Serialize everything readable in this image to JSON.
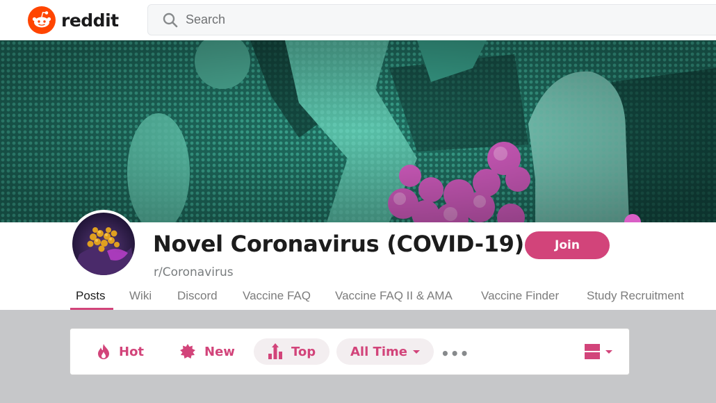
{
  "header": {
    "brand": "reddit",
    "search_placeholder": "Search"
  },
  "subreddit": {
    "title": "Novel Coronavirus (COVID-19)",
    "name": "r/Coronavirus",
    "join_label": "Join"
  },
  "tabs": [
    {
      "label": "Posts",
      "active": true
    },
    {
      "label": "Wiki"
    },
    {
      "label": "Discord"
    },
    {
      "label": "Vaccine FAQ"
    },
    {
      "label": "Vaccine FAQ II & AMA"
    },
    {
      "label": "Vaccine Finder"
    },
    {
      "label": "Study Recruitment"
    }
  ],
  "sort": {
    "hot": "Hot",
    "new": "New",
    "top": "Top",
    "time": "All Time",
    "more": "•••"
  },
  "colors": {
    "accent": "#d2447a",
    "reddit_orange": "#ff4500",
    "banner_teal": "#2e8f7c"
  },
  "icons": {
    "logo": "reddit-logo-icon",
    "search": "search-icon",
    "hot": "flame-icon",
    "new": "burst-icon",
    "top": "bar-chart-up-icon",
    "view": "card-view-icon"
  }
}
